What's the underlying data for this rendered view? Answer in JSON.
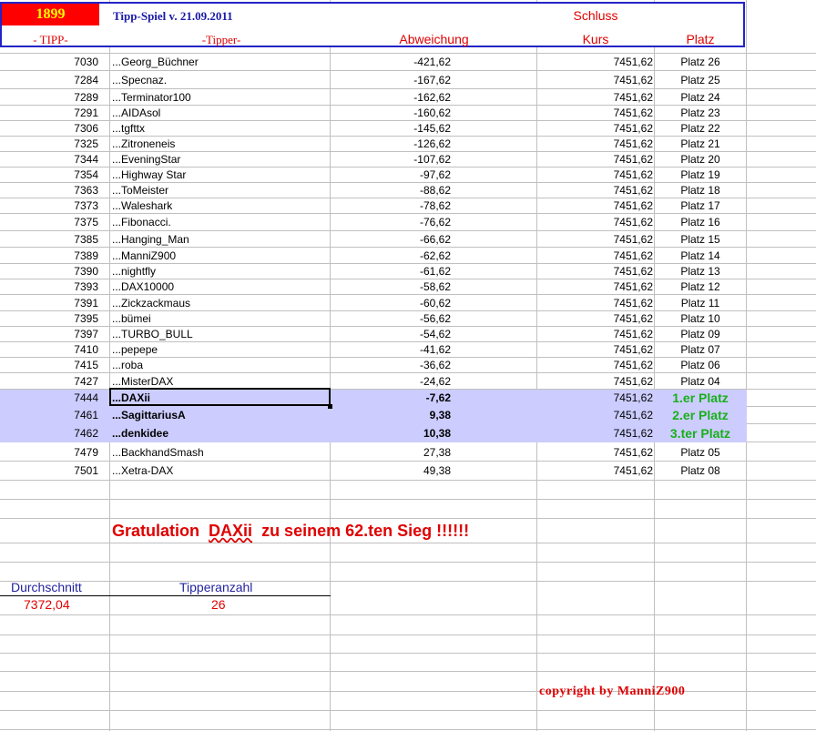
{
  "header": {
    "number": "1899",
    "title": "Tipp-Spiel v. 21.09.2011",
    "schluss": "Schluss",
    "col_tipp": "- TIPP-",
    "col_tipper": "-Tipper-",
    "col_abweichung": "Abweichung",
    "col_kurs": "Kurs",
    "col_platz": "Platz"
  },
  "rows": [
    {
      "tipp": "7030",
      "name": "...Georg_Büchner",
      "abw": "-421,62",
      "kurs": "7451,62",
      "platz": "Platz 26"
    },
    {
      "tipp": "7284",
      "name": "...Specnaz.",
      "abw": "-167,62",
      "kurs": "7451,62",
      "platz": "Platz 25"
    },
    {
      "tipp": "7289",
      "name": "...Terminator100",
      "abw": "-162,62",
      "kurs": "7451,62",
      "platz": "Platz 24"
    },
    {
      "tipp": "7291",
      "name": "...AIDAsol",
      "abw": "-160,62",
      "kurs": "7451,62",
      "platz": "Platz 23"
    },
    {
      "tipp": "7306",
      "name": "...tgfttx",
      "abw": "-145,62",
      "kurs": "7451,62",
      "platz": "Platz 22"
    },
    {
      "tipp": "7325",
      "name": "...Zitroneneis",
      "abw": "-126,62",
      "kurs": "7451,62",
      "platz": "Platz 21"
    },
    {
      "tipp": "7344",
      "name": "...EveningStar",
      "abw": "-107,62",
      "kurs": "7451,62",
      "platz": "Platz 20"
    },
    {
      "tipp": "7354",
      "name": "...Highway Star",
      "abw": "-97,62",
      "kurs": "7451,62",
      "platz": "Platz 19"
    },
    {
      "tipp": "7363",
      "name": "...ToMeister",
      "abw": "-88,62",
      "kurs": "7451,62",
      "platz": "Platz 18"
    },
    {
      "tipp": "7373",
      "name": "...Waleshark",
      "abw": "-78,62",
      "kurs": "7451,62",
      "platz": "Platz 17"
    },
    {
      "tipp": "7375",
      "name": "...Fibonacci.",
      "abw": "-76,62",
      "kurs": "7451,62",
      "platz": "Platz 16"
    },
    {
      "tipp": "7385",
      "name": "...Hanging_Man",
      "abw": "-66,62",
      "kurs": "7451,62",
      "platz": "Platz 15"
    },
    {
      "tipp": "7389",
      "name": "...ManniZ900",
      "abw": "-62,62",
      "kurs": "7451,62",
      "platz": "Platz 14"
    },
    {
      "tipp": "7390",
      "name": "...nightfly",
      "abw": "-61,62",
      "kurs": "7451,62",
      "platz": "Platz 13"
    },
    {
      "tipp": "7393",
      "name": "...DAX10000",
      "abw": "-58,62",
      "kurs": "7451,62",
      "platz": "Platz 12"
    },
    {
      "tipp": "7391",
      "name": "...Zickzackmaus",
      "abw": "-60,62",
      "kurs": "7451,62",
      "platz": "Platz 11"
    },
    {
      "tipp": "7395",
      "name": "...bümei",
      "abw": "-56,62",
      "kurs": "7451,62",
      "platz": "Platz 10"
    },
    {
      "tipp": "7397",
      "name": "...TURBO_BULL",
      "abw": "-54,62",
      "kurs": "7451,62",
      "platz": "Platz 09"
    },
    {
      "tipp": "7410",
      "name": "...pepepe",
      "abw": "-41,62",
      "kurs": "7451,62",
      "platz": "Platz 07"
    },
    {
      "tipp": "7415",
      "name": "...roba",
      "abw": "-36,62",
      "kurs": "7451,62",
      "platz": "Platz 06"
    },
    {
      "tipp": "7427",
      "name": "...MisterDAX",
      "abw": "-24,62",
      "kurs": "7451,62",
      "platz": "Platz 04"
    },
    {
      "tipp": "7444",
      "name": "...DAXii",
      "abw": "-7,62",
      "kurs": "7451,62",
      "platz": "1.er Platz",
      "highlight": true
    },
    {
      "tipp": "7461",
      "name": "...SagittariusA",
      "abw": "9,38",
      "kurs": "7451,62",
      "platz": "2.er Platz",
      "highlight": true
    },
    {
      "tipp": "7462",
      "name": "...denkidee",
      "abw": "10,38",
      "kurs": "7451,62",
      "platz": "3.ter Platz",
      "highlight": true
    },
    {
      "tipp": "7479",
      "name": "...BackhandSmash",
      "abw": "27,38",
      "kurs": "7451,62",
      "platz": "Platz 05"
    },
    {
      "tipp": "7501",
      "name": "...Xetra-DAX",
      "abw": "49,38",
      "kurs": "7451,62",
      "platz": "Platz 08"
    }
  ],
  "gratulation": {
    "prefix": "Gratulation",
    "name": "DAXii",
    "suffix": "zu seinem 62.ten Sieg !!!!!!"
  },
  "stats": {
    "durchschnitt_label": "Durchschnitt",
    "durchschnitt_value": "7372,04",
    "tipperanzahl_label": "Tipperanzahl",
    "tipperanzahl_value": "26"
  },
  "copyright": "copyright by ManniZ900",
  "colors": {
    "highlight": "#ccccff",
    "header_border": "#2323c8",
    "red": "#e00000",
    "green": "#18b018"
  }
}
